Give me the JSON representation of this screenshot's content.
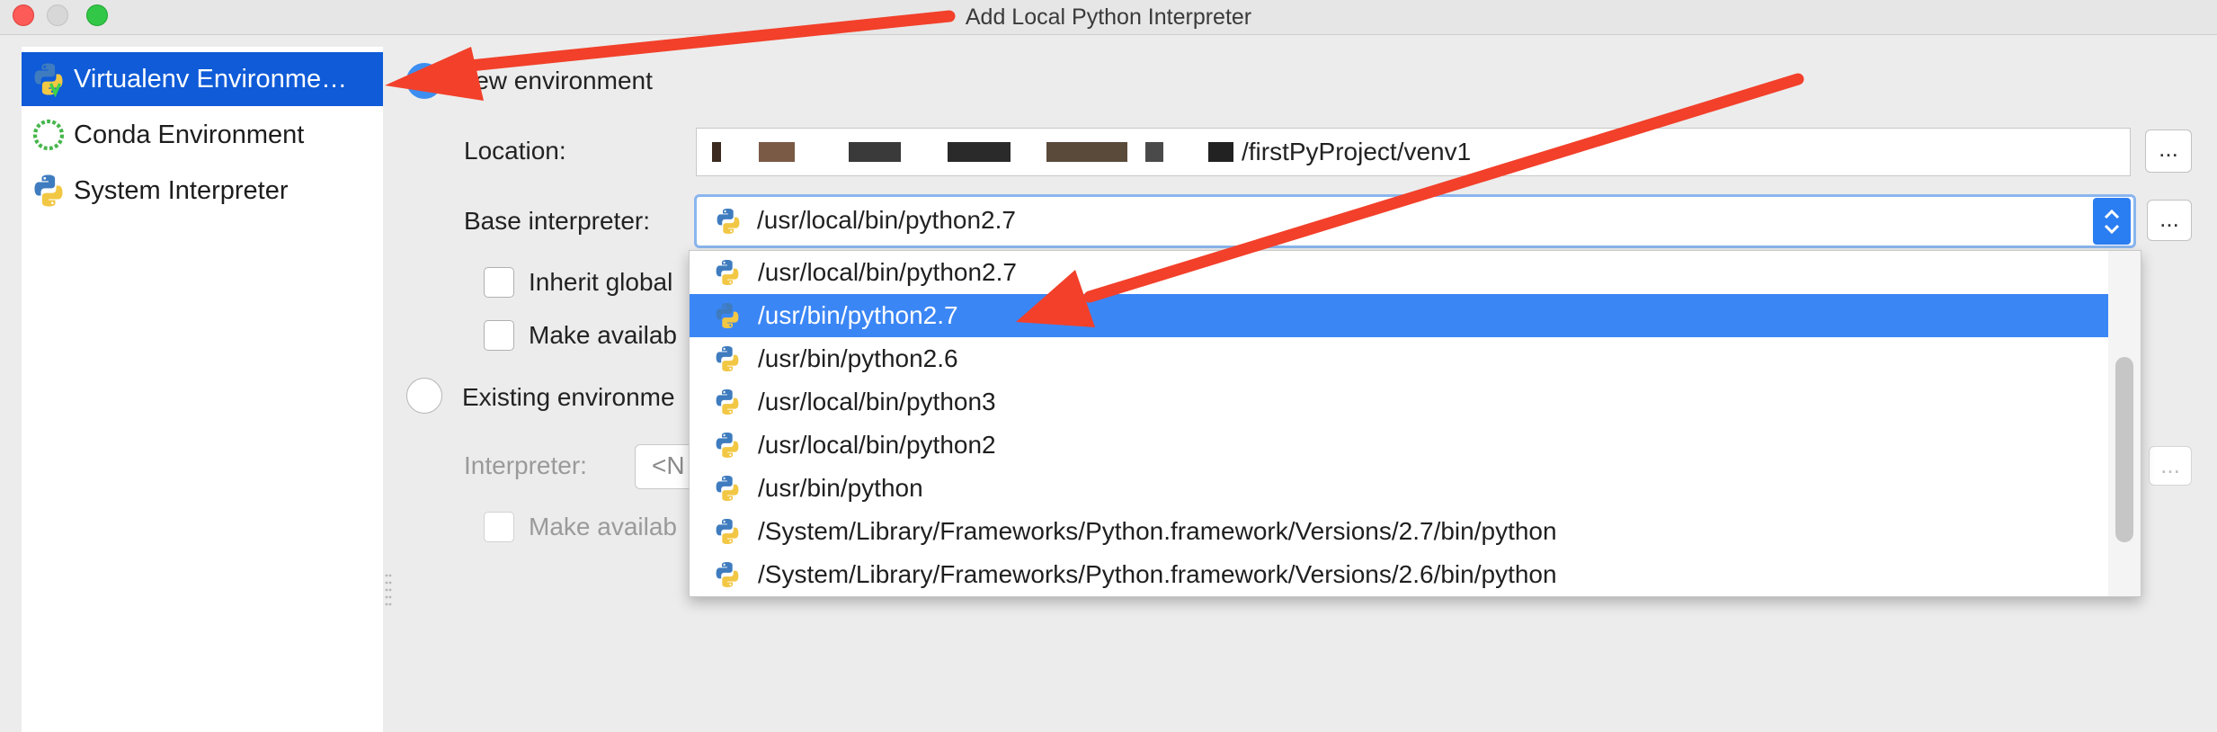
{
  "window": {
    "title": "Add Local Python Interpreter"
  },
  "sidebar": {
    "items": [
      {
        "label": "Virtualenv Environme…",
        "icon": "virtualenv-icon",
        "selected": true
      },
      {
        "label": "Conda Environment",
        "icon": "conda-icon",
        "selected": false
      },
      {
        "label": "System Interpreter",
        "icon": "python-icon",
        "selected": false
      }
    ]
  },
  "main": {
    "new_env_label": "New environment",
    "location_label": "Location:",
    "location_value": "/firstPyProject/venv1",
    "base_interpreter_label": "Base interpreter:",
    "base_interpreter_value": "/usr/local/bin/python2.7",
    "browse_label": "...",
    "inherit_label": "Inherit global",
    "make_available_label": "Make availab",
    "existing_env_label": "Existing environme",
    "interpreter_label": "Interpreter:",
    "interpreter_value": "<N",
    "make_available_disabled_label": "Make availab"
  },
  "dropdown": {
    "options": [
      "/usr/local/bin/python2.7",
      "/usr/bin/python2.7",
      "/usr/bin/python2.6",
      "/usr/local/bin/python3",
      "/usr/local/bin/python2",
      "/usr/bin/python",
      "/System/Library/Frameworks/Python.framework/Versions/2.7/bin/python",
      "/System/Library/Frameworks/Python.framework/Versions/2.6/bin/python"
    ],
    "selected_index": 1
  },
  "colors": {
    "selection_blue": "#3b86f5",
    "sidebar_selection": "#0f5bd8",
    "annotation_arrow": "#f2402a"
  }
}
